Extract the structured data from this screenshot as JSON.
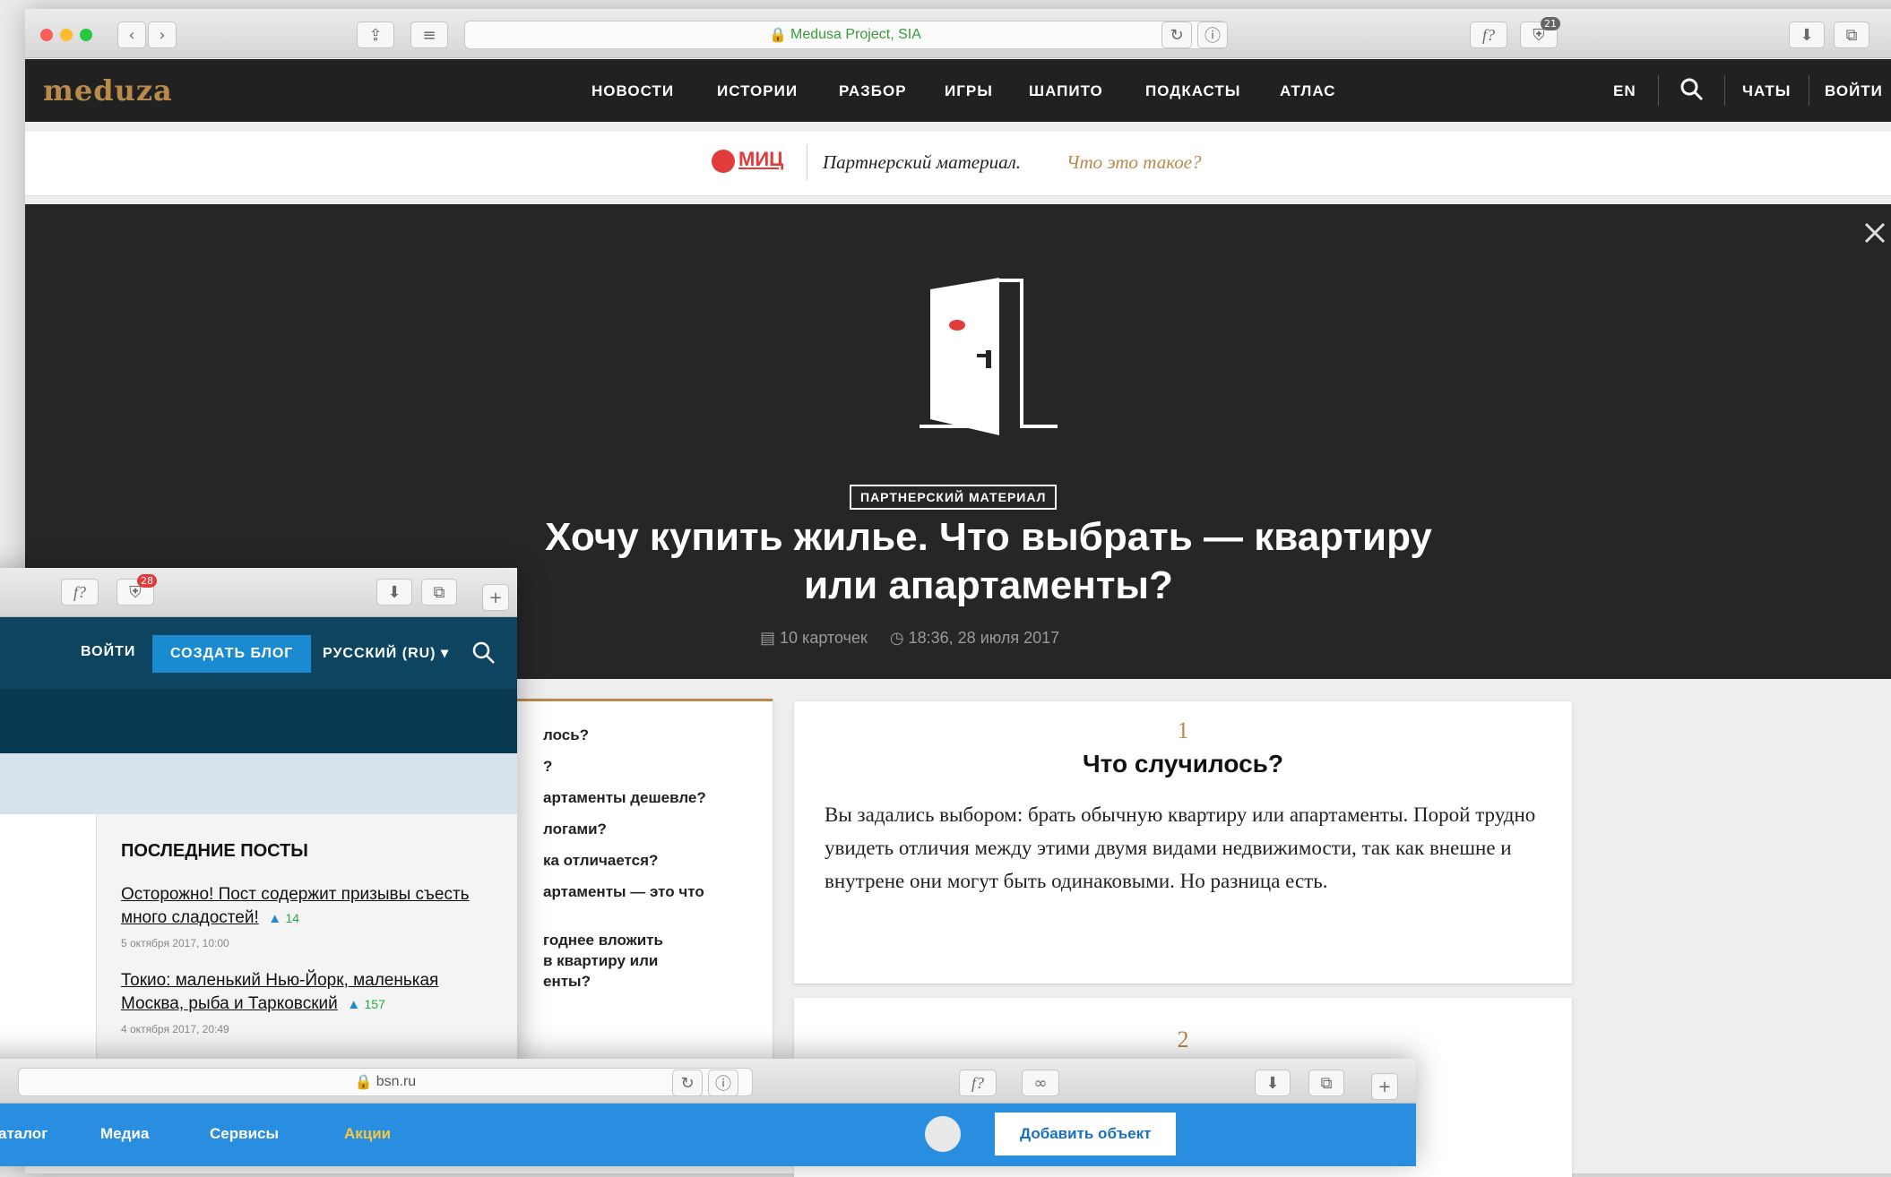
{
  "main_window": {
    "address": "Medusa Project, SIA",
    "fsearch": "f?",
    "badge_count": "21",
    "nav": {
      "logo": "meduza",
      "items": [
        "НОВОСТИ",
        "ИСТОРИИ",
        "РАЗБОР",
        "ИГРЫ",
        "ШАПИТО",
        "ПОДКАСТЫ",
        "АТЛАС"
      ],
      "lang": "EN",
      "chats": "ЧАТЫ",
      "login": "ВОЙТИ"
    },
    "partner_bar": {
      "logo_text": "МИЦ",
      "label": "Партнерский материал.",
      "link": "Что это такое?"
    },
    "hero": {
      "badge": "ПАРТНЕРСКИЙ МАТЕРИАЛ",
      "title": "Хочу купить жилье. Что выбрать — квартиру или апартаменты?",
      "cards": "10 карточек",
      "time": "18:36, 28 июля 2017"
    },
    "toc_fragments": [
      "лось?",
      "?",
      "артаменты дешевле?",
      "логами?",
      "ка отличается?",
      "артаменты — это что",
      "годнее вложить",
      "в квартиру или",
      "енты?"
    ],
    "cards": [
      {
        "number": "1",
        "title": "Что случилось?",
        "text": "Вы задались выбором: брать обычную квартиру или апартаменты. Порой трудно увидеть отличия между этими двумя видами недвижимости, так как внешне и внутрене они могут быть одинаковыми. Но разница есть."
      },
      {
        "number": "2"
      }
    ]
  },
  "window2": {
    "fsearch": "f?",
    "badge_count": "28",
    "nav": {
      "login": "ВОЙТИ",
      "create": "СОЗДАТЬ БЛОГ",
      "lang": "РУССКИЙ (RU)"
    },
    "section_title": "ПОСЛЕДНИЕ ПОСТЫ",
    "posts": [
      {
        "title": "Осторожно! Пост содержит призывы съесть много сладостей!",
        "likes": "14",
        "date": "5 октября 2017, 10:00"
      },
      {
        "title": "Токио: маленький Нью-Йорк, маленькая Москва, рыба и Тарковский",
        "likes": "157",
        "date": "4 октября 2017, 20:49"
      }
    ]
  },
  "window3": {
    "address": "bsn.ru",
    "fsearch": "f?",
    "nav": [
      "аталог",
      "Медиа",
      "Сервисы",
      "Акции"
    ],
    "add_button": "Добавить объект"
  }
}
